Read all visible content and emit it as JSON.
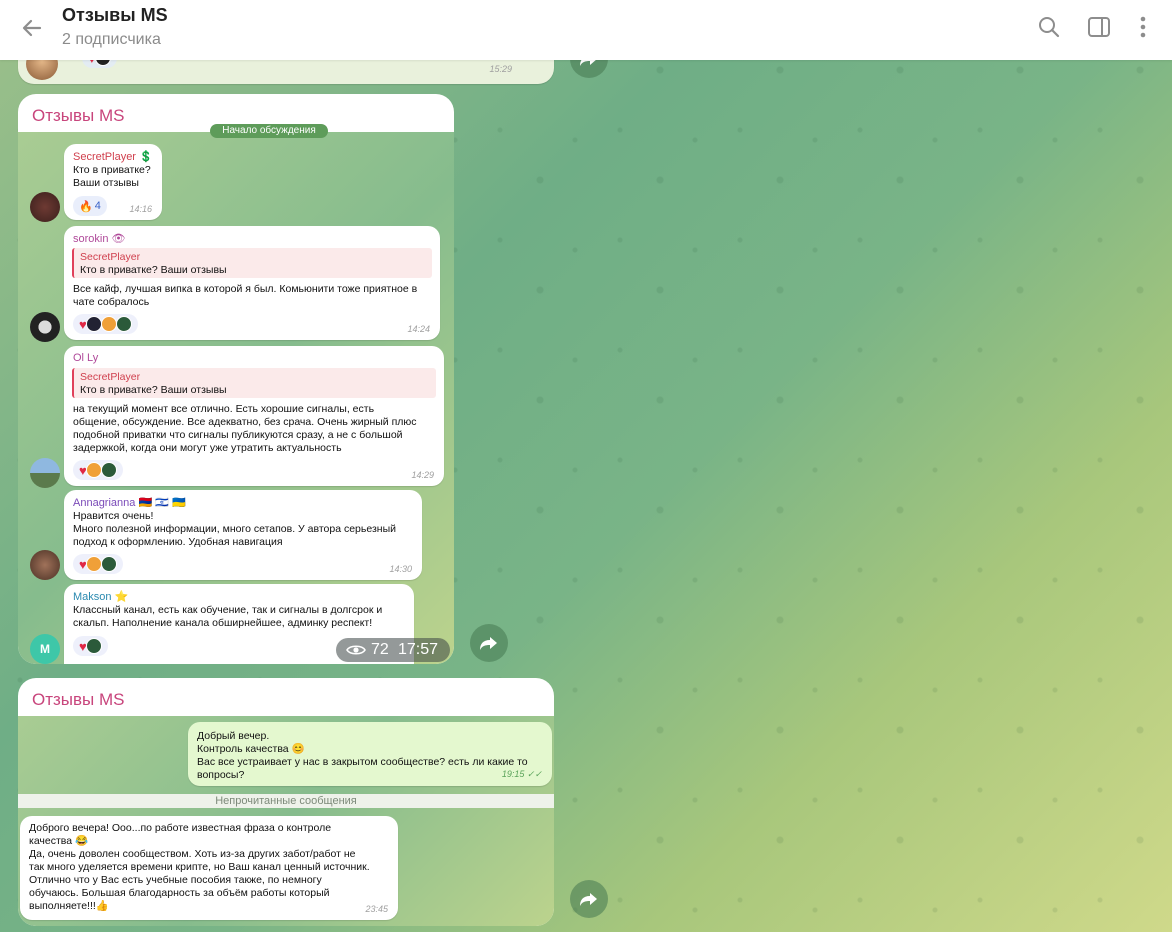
{
  "header": {
    "title": "Отзывы MS",
    "subtitle": "2 подписчика"
  },
  "top_partial": {
    "time": "15:29"
  },
  "card1": {
    "title": "Отзывы MS",
    "divider": "Начало обсуждения",
    "messages": [
      {
        "name": "SecretPlayer 💲",
        "name_color": "#d0404e",
        "text": "Кто в приватке?\nВаши отзывы",
        "react_emoji": "🔥",
        "react_count": "4",
        "time": "14:16"
      },
      {
        "name": "sorokin 👁",
        "name_color": "#b04a9a",
        "quote_author": "SecretPlayer",
        "quote_text": "Кто в приватке?  Ваши отзывы",
        "text": "Все кайф, лучшая випка в которой я был. Комьюнити тоже приятное в\nчате собралось",
        "time": "14:24"
      },
      {
        "name": "Ol Ly",
        "name_color": "#b04a9a",
        "quote_author": "SecretPlayer",
        "quote_text": "Кто в приватке?  Ваши отзывы",
        "text": "на текущий момент все отлично. Есть хорошие сигналы, есть\nобщение, обсуждение. Все адекватно, без срача. Очень жирный плюс\nподобной приватки что сигналы публикуются сразу, а не с большой\nзадержкой, когда они могут уже утратить актуальность",
        "time": "14:29"
      },
      {
        "name": "Annagrianna 🇦🇲 🇮🇱 🇺🇦",
        "name_color": "#7a4ab8",
        "text": "Нравится очень!\nМного полезной информации, много сетапов. У автора серьезный\nподход к оформлению. Удобная навигация",
        "time": "14:30"
      },
      {
        "name": "Makson ⭐",
        "name_color": "#2a8ab0",
        "text": "Классный канал, есть как обучение, так и сигналы в долгсрок и\nскальп. Наполнение канала обширнейшее, админку респект!",
        "avatar_letter": "M"
      }
    ],
    "views": "72",
    "time": "17:57"
  },
  "card2": {
    "title": "Отзывы MS",
    "outgoing": {
      "text": "Добрый вечер.\nКонтроль качества 😊\nВас все устраивает у нас в закрытом сообществе? есть ли какие то\nвопросы?",
      "time": "19:15 ✓✓"
    },
    "unread": "Непрочитанные сообщения",
    "incoming": {
      "text": "Доброго вечера! Ооо...по работе известная фраза о контроле\nкачества 😂\nДа, очень доволен сообществом. Хоть из-за других забот/работ не\nтак много уделяется времени крипте, но Ваш канал ценный источник.\nОтлично что у Вас есть учебные пособия также, по немногу\nобучаюсь. Большая благодарность за объём работы который\nвыполняете!!!👍",
      "time": "23:45"
    }
  },
  "icons": [
    "back-arrow-icon",
    "search-icon",
    "sidebar-toggle-icon",
    "more-vertical-icon",
    "forward-icon",
    "eye-icon"
  ]
}
